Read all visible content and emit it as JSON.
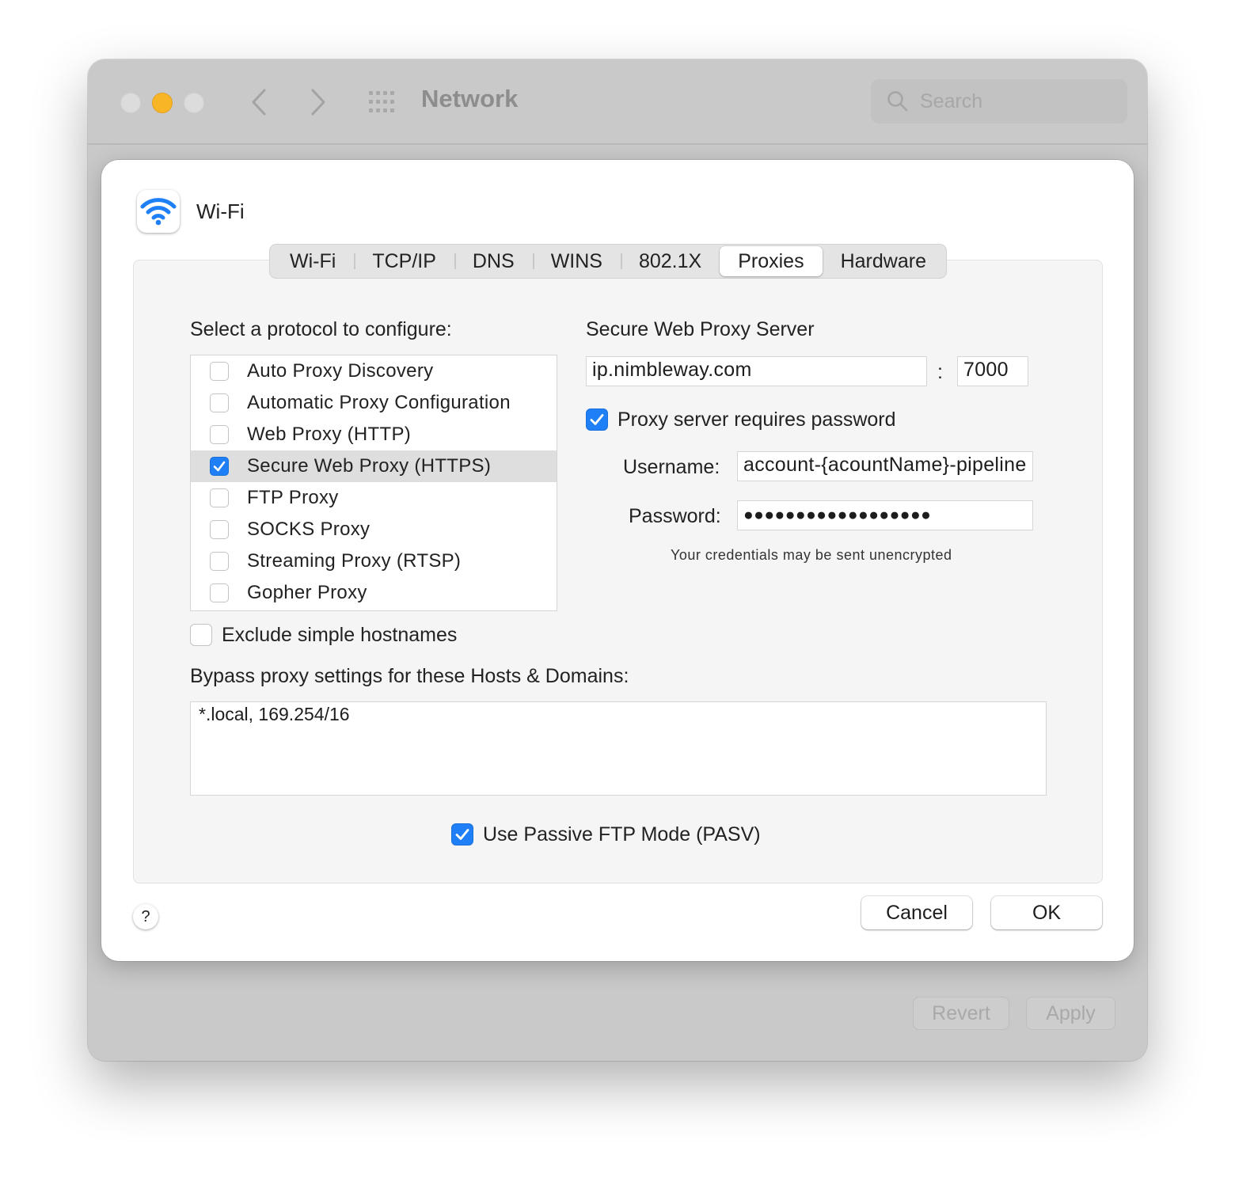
{
  "window": {
    "title": "Network",
    "search_placeholder": "Search",
    "revert_label": "Revert",
    "apply_label": "Apply"
  },
  "sheet": {
    "service_name": "Wi-Fi",
    "service_icon": "wifi-icon",
    "tabs": [
      {
        "label": "Wi-Fi",
        "active": false
      },
      {
        "label": "TCP/IP",
        "active": false
      },
      {
        "label": "DNS",
        "active": false
      },
      {
        "label": "WINS",
        "active": false
      },
      {
        "label": "802.1X",
        "active": false
      },
      {
        "label": "Proxies",
        "active": true
      },
      {
        "label": "Hardware",
        "active": false
      }
    ],
    "protocol_heading": "Select a protocol to configure:",
    "protocols": [
      {
        "label": "Auto Proxy Discovery",
        "checked": false,
        "selected": false
      },
      {
        "label": "Automatic Proxy Configuration",
        "checked": false,
        "selected": false
      },
      {
        "label": "Web Proxy (HTTP)",
        "checked": false,
        "selected": false
      },
      {
        "label": "Secure Web Proxy (HTTPS)",
        "checked": true,
        "selected": true
      },
      {
        "label": "FTP Proxy",
        "checked": false,
        "selected": false
      },
      {
        "label": "SOCKS Proxy",
        "checked": false,
        "selected": false
      },
      {
        "label": "Streaming Proxy (RTSP)",
        "checked": false,
        "selected": false
      },
      {
        "label": "Gopher Proxy",
        "checked": false,
        "selected": false
      }
    ],
    "server_heading": "Secure Web Proxy Server",
    "server_host": "ip.nimbleway.com",
    "port_separator": ":",
    "server_port": "7000",
    "requires_password_label": "Proxy server requires password",
    "requires_password_checked": true,
    "username_label": "Username:",
    "username_value": "account-{acountName}-pipeline",
    "password_label": "Password:",
    "password_value": "●●●●●●●●●●●●●●●●●●",
    "credentials_hint": "Your credentials may be sent unencrypted",
    "exclude_simple_label": "Exclude simple hostnames",
    "exclude_simple_checked": false,
    "bypass_heading": "Bypass proxy settings for these Hosts & Domains:",
    "bypass_value": "*.local, 169.254/16",
    "passive_ftp_label": "Use Passive FTP Mode (PASV)",
    "passive_ftp_checked": true,
    "help_label": "?",
    "cancel_label": "Cancel",
    "ok_label": "OK"
  },
  "colors": {
    "accent": "#1f7ff7",
    "minimize": "#f8b526"
  }
}
